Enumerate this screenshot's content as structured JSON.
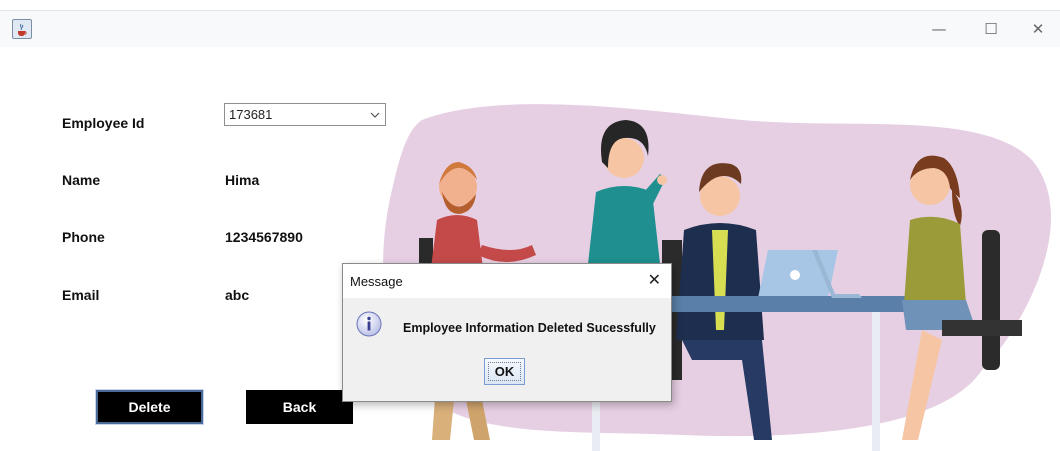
{
  "window": {
    "title": "",
    "icon": "java-cup-icon",
    "controls": {
      "minimize": "—",
      "maximize": "☐",
      "close": "✕"
    }
  },
  "form": {
    "employee_id": {
      "label": "Employee Id",
      "selected": "173681"
    },
    "name": {
      "label": "Name",
      "value": "Hima"
    },
    "phone": {
      "label": "Phone",
      "value": "1234567890"
    },
    "email": {
      "label": "Email",
      "value": "abc"
    }
  },
  "buttons": {
    "delete": "Delete",
    "back": "Back"
  },
  "dialog": {
    "title": "Message",
    "close_glyph": "✕",
    "icon": "info-icon",
    "message": "Employee Information Deleted Sucessfully",
    "ok_label": "OK"
  },
  "colors": {
    "blob": "#e7cfe3",
    "button_bg": "#000000",
    "accent_focus": "#4a6a99"
  }
}
